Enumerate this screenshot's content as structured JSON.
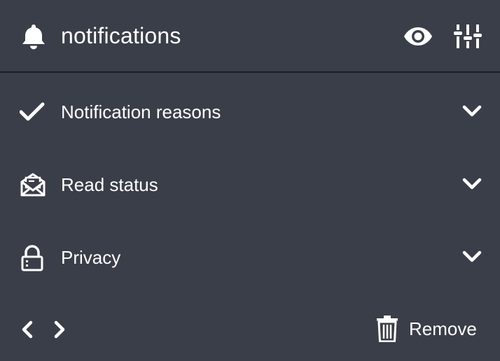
{
  "header": {
    "title": "notifications",
    "icons": {
      "left": "bell-icon",
      "visibility": "eye-icon",
      "settings": "sliders-icon"
    }
  },
  "sections": [
    {
      "label": "Notification reasons",
      "icon": "checkmark-icon",
      "expander": "chevron-down-icon"
    },
    {
      "label": "Read status",
      "icon": "open-envelope-icon",
      "expander": "chevron-down-icon"
    },
    {
      "label": "Privacy",
      "icon": "padlock-icon",
      "expander": "chevron-down-icon"
    }
  ],
  "footer": {
    "remove_label": "Remove",
    "icons": {
      "previous": "chevron-left-icon",
      "next": "chevron-right-icon",
      "remove": "trash-icon"
    }
  },
  "colors": {
    "background": "#3a3e48",
    "divider": "#1b1d22",
    "foreground": "#ffffff"
  }
}
